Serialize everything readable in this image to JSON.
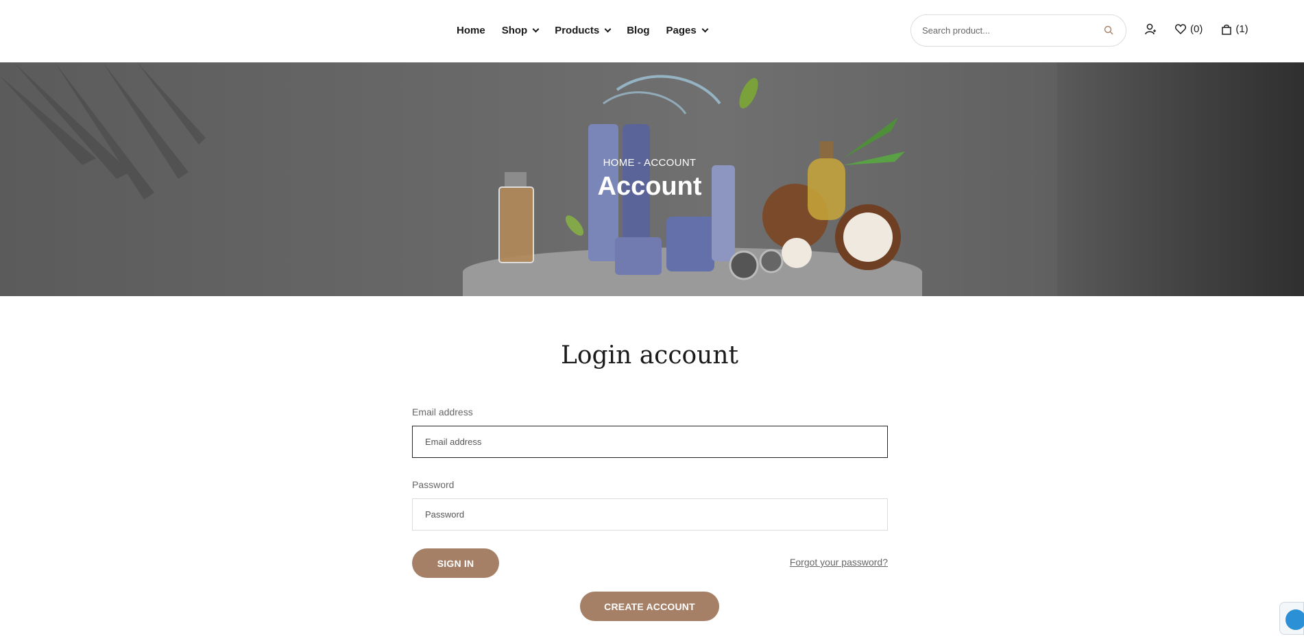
{
  "header": {
    "nav": [
      {
        "label": "Home",
        "has_dropdown": false
      },
      {
        "label": "Shop",
        "has_dropdown": true
      },
      {
        "label": "Products",
        "has_dropdown": true
      },
      {
        "label": "Blog",
        "has_dropdown": false
      },
      {
        "label": "Pages",
        "has_dropdown": true
      }
    ],
    "search": {
      "placeholder": "Search product...",
      "icon": "search-icon"
    },
    "account_icon": "user-icon",
    "wishlist": {
      "icon": "heart-icon",
      "count_label": "(0)"
    },
    "cart": {
      "icon": "bag-icon",
      "count_label": "(1)"
    }
  },
  "hero": {
    "breadcrumb": {
      "home": "HOME",
      "separator": "-",
      "current": "ACCOUNT"
    },
    "title": "Account"
  },
  "login": {
    "title": "Login account",
    "email": {
      "label": "Email address",
      "placeholder": "Email address",
      "value": ""
    },
    "password": {
      "label": "Password",
      "placeholder": "Password",
      "value": ""
    },
    "signin_label": "SIGN IN",
    "forgot_label": "Forgot your password?",
    "create_label": "CREATE ACCOUNT"
  },
  "colors": {
    "accent": "#a58067",
    "text": "#1a1a1a",
    "muted": "#666666",
    "border": "#dcdcdc"
  }
}
